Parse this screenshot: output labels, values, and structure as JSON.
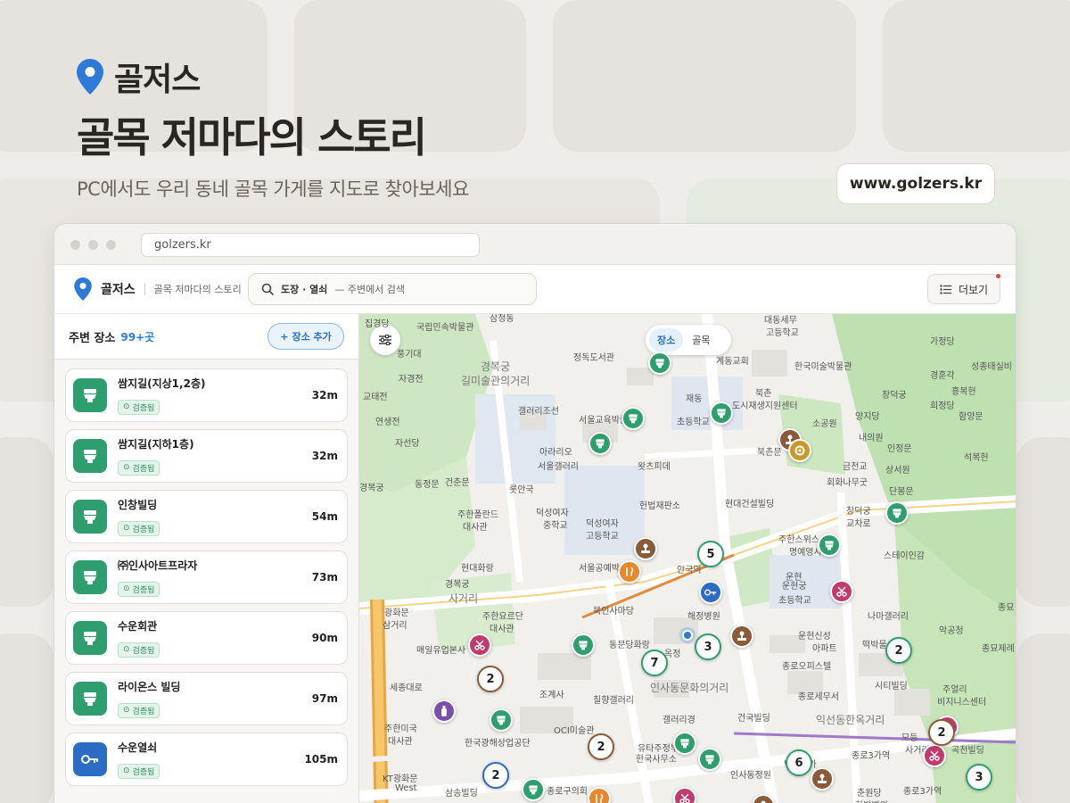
{
  "hero": {
    "brand": "골저스",
    "title": "골목 저마다의 스토리",
    "subtitle": "PC에서도 우리 동네 골목 가게를 지도로 찾아보세요",
    "site_url": "www.golzers.kr"
  },
  "browser": {
    "address": "golzers.kr"
  },
  "header": {
    "app_name": "골저스",
    "tagline": "골목 저마다의 스토리",
    "search_keyword": "도장 · 열쇠",
    "search_hint": "— 주변에서 검색",
    "more_label": "더보기"
  },
  "sidebar": {
    "heading": "주변 장소",
    "count": "99+곳",
    "add_label": "장소 추가",
    "badge_label": "검증됨",
    "items": [
      {
        "name": "쌈지길(지상1,2층)",
        "distance": "32m",
        "icon": "toilet-icon"
      },
      {
        "name": "쌈지길(지하1층)",
        "distance": "32m",
        "icon": "toilet-icon"
      },
      {
        "name": "인창빌딩",
        "distance": "54m",
        "icon": "toilet-icon"
      },
      {
        "name": "㈜인사아트프라자",
        "distance": "73m",
        "icon": "toilet-icon"
      },
      {
        "name": "수운회관",
        "distance": "90m",
        "icon": "toilet-icon"
      },
      {
        "name": "라이온스 빌딩",
        "distance": "97m",
        "icon": "toilet-icon"
      },
      {
        "name": "수운열쇠",
        "distance": "105m",
        "icon": "key-icon"
      }
    ]
  },
  "map": {
    "toggle": {
      "active": "장소",
      "inactive": "골목"
    },
    "labels": {
      "l1": "집경당",
      "l2": "국립민속박물관",
      "l3": "삼청동",
      "l4": "풍기대",
      "l5": "정독도서관",
      "l6": "경복궁",
      "l7": "길미술관의거리",
      "l8": "자경전",
      "l9": "교태전",
      "l10": "연생전",
      "l11": "자선당",
      "l12": "경복궁",
      "l13": "동정문",
      "l14": "건춘문",
      "l15": "갤러리조선",
      "l16": "서울교육박물관",
      "l17": "아라리오",
      "l18": "서울갤러리",
      "l19": "왓츠피데",
      "l20": "롯안국",
      "l21": "덕성여자",
      "l22": "중학교",
      "l23": "덕성여자",
      "l24": "고등학교",
      "l25": "헌법재판소",
      "l26": "현대건설빌딩",
      "l27": "주한폴란드",
      "l28": "대사관",
      "l29": "현대화랑",
      "l30": "서울공예박",
      "l31": "경복궁",
      "l32": "사거리",
      "l33": "북인사마당",
      "l34": "안국역",
      "l35": "해정병원",
      "l36": "운현",
      "l37": "초등학교",
      "l38": "주한요르단",
      "l39": "대사관",
      "l40": "광화문",
      "l41": "삼거리",
      "l42": "매일유업본사",
      "l43": "동문당화랑",
      "l44": "옥정",
      "l45": "인사동문화의거리",
      "l46": "조계사",
      "l47": "칠향갤러리",
      "l48": "갤러리경",
      "l49": "건국빌딩",
      "l50": "OCI미술관",
      "l51": "주한미국",
      "l52": "대사관",
      "l53": "한국광해상업공단",
      "l54": "유타주정부",
      "l55": "한국사무소",
      "l56": "인사동정원",
      "l57": "KT광화문",
      "l58": "West",
      "l59": "종로구의회",
      "l60": "삼송빌딩",
      "l61": "계동교회",
      "l62": "대동세무",
      "l63": "고등학교",
      "l64": "한국미술박물관",
      "l65": "북촌",
      "l66": "도시재생지원센터",
      "l67": "소공원",
      "l68": "양지당",
      "l69": "내의원",
      "l70": "인정문",
      "l71": "금천교",
      "l72": "상서원",
      "l73": "회화나무굿",
      "l74": "단봉문",
      "l75": "창덕궁",
      "l76": "교차로",
      "l77": "주한스위스",
      "l78": "명예영사관",
      "l79": "스테이인감",
      "l80": "운현궁",
      "l81": "운현신성",
      "l82": "아파트",
      "l83": "종로오피스텔",
      "l84": "나마갤러리",
      "l85": "떡박물",
      "l86": "시티빌딩",
      "l87": "종로세무서",
      "l88": "익선동한옥거리",
      "l89": "낙원상가",
      "l90": "종로3가역",
      "l91": "춘원당",
      "l92": "한방병원",
      "l93": "주얼리",
      "l94": "비지니스센터",
      "l95": "곡천빌딩",
      "l96": "가정당",
      "l97": "성종태실비",
      "l98": "경훈각",
      "l99": "흥복헌",
      "l100": "희정당",
      "l101": "함양문",
      "l102": "석복헌",
      "l103": "창덕궁",
      "l104": "종묘",
      "l105": "악공청",
      "l106": "종묘제례",
      "l107": "세종대로",
      "l108": "재동",
      "l109": "초등학교",
      "l110": "북촌문",
      "l111": "하문",
      "l112": "모등",
      "l113": "사거리",
      "l114": "종로3가역"
    },
    "clusters": [
      "5",
      "3",
      "7",
      "2",
      "2",
      "2",
      "6",
      "3",
      "2",
      "2"
    ]
  }
}
